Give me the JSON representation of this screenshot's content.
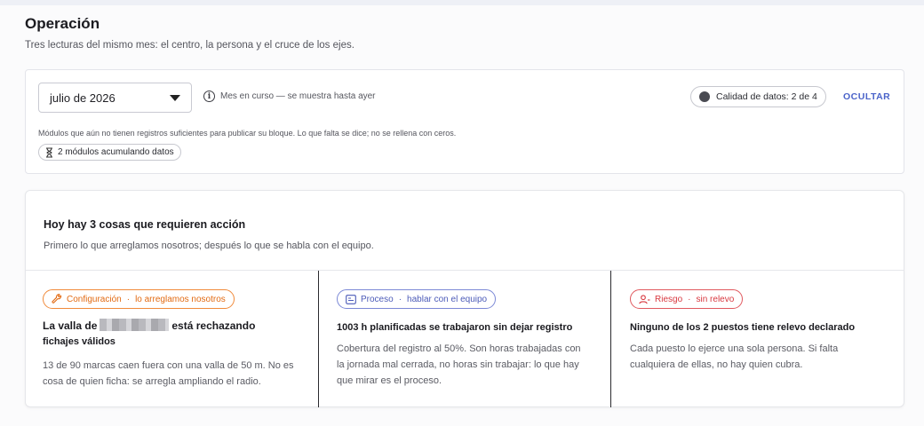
{
  "page": {
    "title": "Operación",
    "subtitle": "Tres lecturas del mismo mes: el centro, la persona y el cruce de los ejes."
  },
  "filters": {
    "month_value": "julio de 2026",
    "status_note": "Mes en curso — se muestra hasta ayer",
    "data_quality": "Calidad de datos: 2 de 4",
    "hide_label": "OCULTAR",
    "modules_note": "Módulos que aún no tienen registros suficientes para publicar su bloque. Lo que falta se dice; no se rellena con ceros.",
    "modules_chip": "2 módulos acumulando datos"
  },
  "actions": {
    "title": "Hoy hay 3 cosas que requieren acción",
    "subtitle": "Primero lo que arreglamos nosotros; después lo que se habla con el equipo.",
    "cards": [
      {
        "tag_category": "Configuración",
        "tag_detail": "lo arreglamos nosotros",
        "title_before": "La valla de",
        "title_after": "está rechazando",
        "title_line2": "fichajes válidos",
        "body": "13 de 90 marcas caen fuera con una valla de 50 m. No es cosa de quien ficha: se arregla ampliando el radio."
      },
      {
        "tag_category": "Proceso",
        "tag_detail": "hablar con el equipo",
        "title": "1003 h planificadas se trabajaron sin dejar registro",
        "body": "Cobertura del registro al 50%. Son horas trabajadas con la jornada mal cerrada, no horas sin trabajar: lo que hay que mirar es el proceso."
      },
      {
        "tag_category": "Riesgo",
        "tag_detail": "sin relevo",
        "title": "Ninguno de los 2 puestos tiene relevo declarado",
        "body": "Cada puesto lo ejerce una sola persona. Si falta cualquiera de ellas, no hay quien cubra."
      }
    ]
  },
  "colors": {
    "accent": "#4a63c9",
    "config": "#e26a12",
    "process": "#4c5bb8",
    "risk": "#d8383f"
  },
  "icons": [
    "info-icon",
    "caret-down-icon",
    "status-dot-icon",
    "hourglass-icon",
    "wrench-icon",
    "board-icon",
    "person-alert-icon"
  ]
}
